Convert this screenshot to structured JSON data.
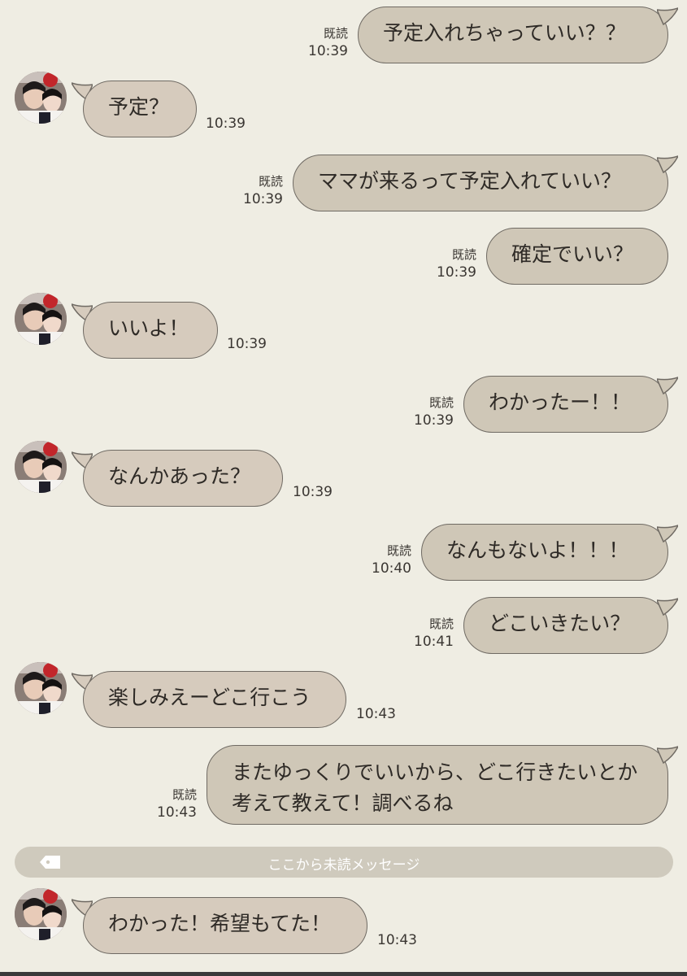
{
  "chat": {
    "read_label": "既読",
    "unread_divider": "ここから未読メッセージ",
    "messages": [
      {
        "dir": "out",
        "text": "予定入れちゃっていい？？",
        "time": "10:39",
        "read": true
      },
      {
        "dir": "in",
        "text": "予定？",
        "time": "10:39"
      },
      {
        "dir": "out",
        "text": "ママが来るって予定入れていい？",
        "time": "10:39",
        "read": true
      },
      {
        "dir": "out",
        "text": "確定でいい？",
        "time": "10:39",
        "read": true
      },
      {
        "dir": "in",
        "text": "いいよ！",
        "time": "10:39"
      },
      {
        "dir": "out",
        "text": "わかったー！！",
        "time": "10:39",
        "read": true
      },
      {
        "dir": "in",
        "text": "なんかあった？",
        "time": "10:39"
      },
      {
        "dir": "out",
        "text": "なんもないよ！！！",
        "time": "10:40",
        "read": true
      },
      {
        "dir": "out",
        "text": "どこいきたい？",
        "time": "10:41",
        "read": true
      },
      {
        "dir": "in",
        "text": "楽しみえーどこ行こう",
        "time": "10:43"
      },
      {
        "dir": "out",
        "text": "またゆっくりでいいから、どこ行きたいとか考えて教えて！調べるね",
        "time": "10:43",
        "read": true
      },
      {
        "dir": "in",
        "text": "わかった！希望もてた！",
        "time": "10:43"
      }
    ]
  },
  "colors": {
    "background": "#efede3",
    "outgoing_bubble": "#cfc7b7",
    "incoming_bubble": "#d6cbbd",
    "bubble_border": "#6f6a63",
    "divider_bar": "#cfcabd"
  },
  "icons": {
    "divider": "tag-icon",
    "avatar": "contact-avatar"
  }
}
